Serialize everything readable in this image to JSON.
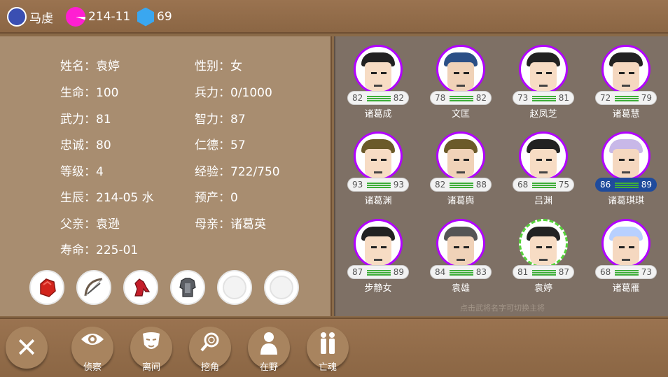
{
  "topbar": {
    "ruler": "马虔",
    "date": "214-11",
    "gems": "69"
  },
  "info": {
    "name_label": "姓名：",
    "name": "袁婷",
    "gender_label": "性别：",
    "gender": "女",
    "life_label": "生命：",
    "life": "100",
    "troops_label": "兵力：",
    "troops": "0/1000",
    "force_label": "武力：",
    "force": "81",
    "intel_label": "智力：",
    "intel": "87",
    "loyalty_label": "忠诚：",
    "loyalty": "80",
    "virtue_label": "仁德：",
    "virtue": "57",
    "level_label": "等级：",
    "level": "4",
    "exp_label": "经验：",
    "exp": "722/750",
    "birth_label": "生辰：",
    "birth": "214-05 水",
    "due_label": "预产：",
    "due": "0",
    "father_label": "父亲：",
    "father": "袁逊",
    "mother_label": "母亲：",
    "mother": "诸葛英",
    "lifespan_label": "寿命：",
    "lifespan": "225-01"
  },
  "items": [
    "red-gem-item",
    "bow-item",
    "horse-item",
    "armor-item",
    "empty-slot",
    "empty-slot"
  ],
  "generals": [
    {
      "name": "诸葛成",
      "a": "82",
      "b": "82"
    },
    {
      "name": "文匡",
      "a": "78",
      "b": "82"
    },
    {
      "name": "赵凤芝",
      "a": "73",
      "b": "81"
    },
    {
      "name": "诸葛慧",
      "a": "72",
      "b": "79"
    },
    {
      "name": "诸葛渊",
      "a": "93",
      "b": "93"
    },
    {
      "name": "诸葛舆",
      "a": "82",
      "b": "88"
    },
    {
      "name": "吕渊",
      "a": "68",
      "b": "75"
    },
    {
      "name": "诸葛琪琪",
      "a": "86",
      "b": "89"
    },
    {
      "name": "步静女",
      "a": "87",
      "b": "89"
    },
    {
      "name": "袁雄",
      "a": "84",
      "b": "83"
    },
    {
      "name": "袁婷",
      "a": "81",
      "b": "87"
    },
    {
      "name": "诸葛雁",
      "a": "68",
      "b": "73"
    }
  ],
  "hint": "点击武将名字可切换主将",
  "actions": {
    "close": "✕",
    "scout": "侦察",
    "sow_discord": "离间",
    "poach": "挖角",
    "wild": "在野",
    "souls": "亡魂"
  },
  "colors": {
    "portrait_ring": "#b100ff",
    "current_ring": "#55d23a",
    "highlight_stat": "#1f4b9c"
  }
}
